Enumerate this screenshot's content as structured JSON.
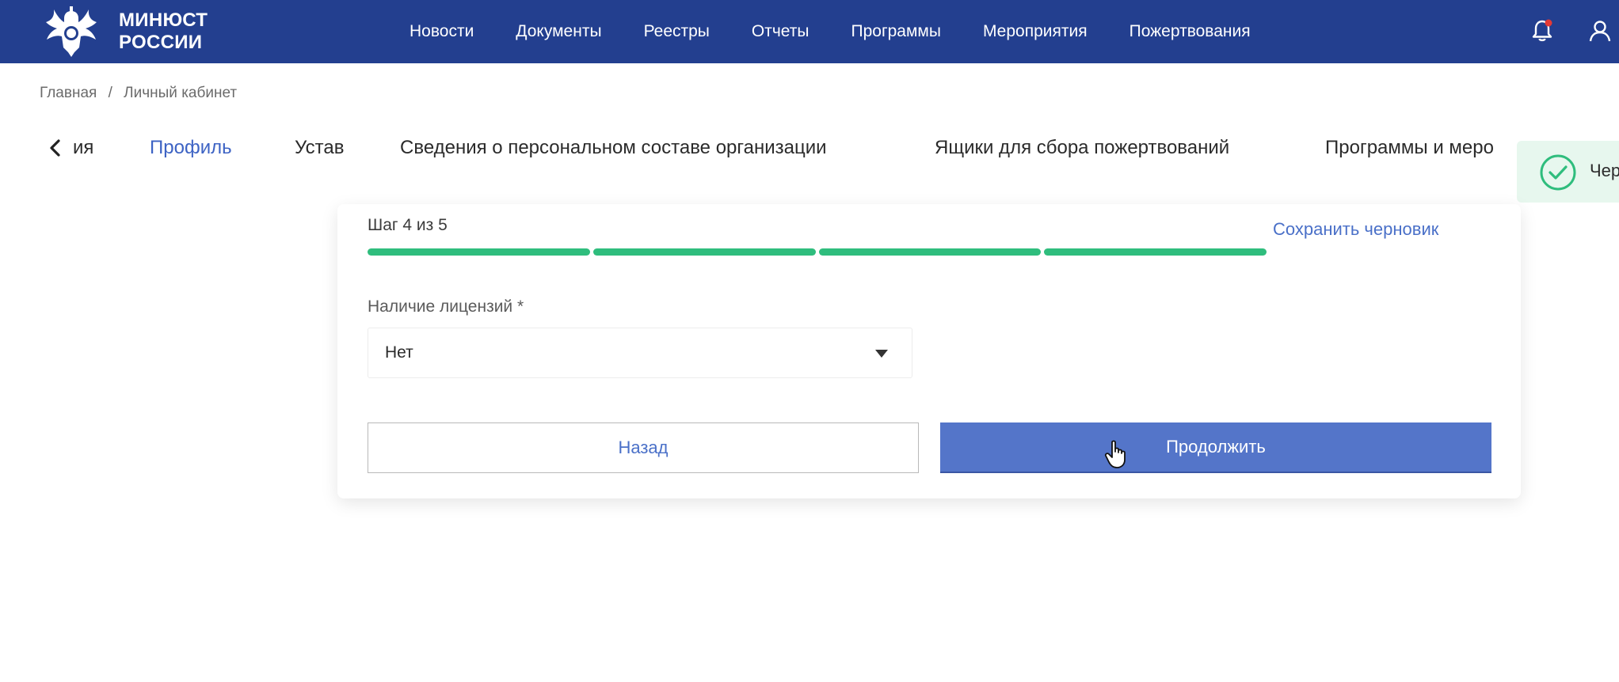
{
  "header": {
    "brand_line1": "МИНЮСТ",
    "brand_line2": "РОССИИ",
    "nav": [
      "Новости",
      "Документы",
      "Реестры",
      "Отчеты",
      "Программы",
      "Мероприятия",
      "Пожертвования"
    ],
    "icons": [
      "logo-eagle-icon",
      "bell-icon",
      "user-icon"
    ],
    "bell_has_notification": true
  },
  "breadcrumb": {
    "home": "Главная",
    "separator": "/",
    "current": "Личный кабинет"
  },
  "tabs": {
    "items": [
      "ия",
      "Профиль",
      "Устав",
      "Сведения о персональном составе организации",
      "Ящики для сбора пожертвований",
      "Программы и меро"
    ],
    "active_index": 1
  },
  "toast": {
    "text": "Чер",
    "icon": "check-circle-icon"
  },
  "form": {
    "step_label": "Шаг 4 из 5",
    "save_draft_label": "Сохранить черновик",
    "progress": {
      "total_steps": 5,
      "filled_segments": 4
    },
    "field_label": "Наличие лицензий *",
    "select_value": "Нет",
    "back_label": "Назад",
    "continue_label": "Продолжить"
  },
  "colors": {
    "header_bg": "#233f8f",
    "accent": "#3d63c4",
    "primary_button": "#5475c9",
    "progress": "#2fbd7d",
    "toast_bg": "#e7f7ee",
    "notification_dot": "#e53935"
  }
}
